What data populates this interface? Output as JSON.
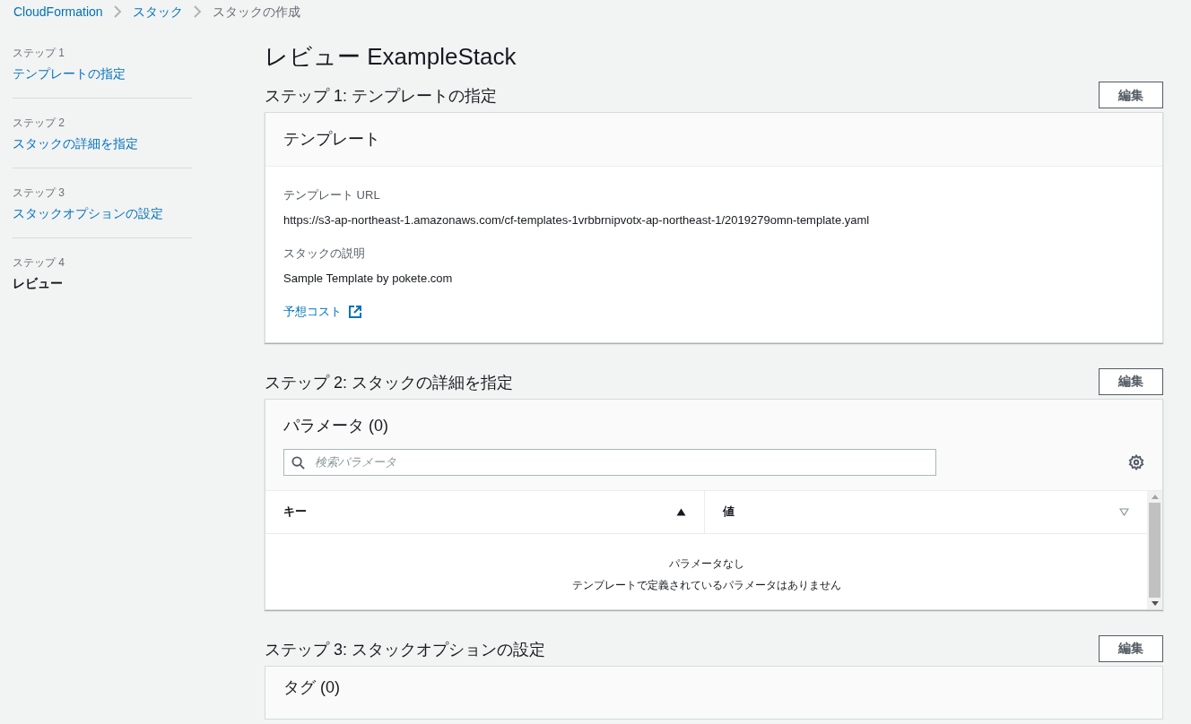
{
  "breadcrumb": [
    {
      "label": "CloudFormation",
      "link": true
    },
    {
      "label": "スタック",
      "link": true
    },
    {
      "label": "スタックの作成",
      "link": false
    }
  ],
  "steps": [
    {
      "label": "ステップ 1",
      "title": "テンプレートの指定",
      "selected": false
    },
    {
      "label": "ステップ 2",
      "title": "スタックの詳細を指定",
      "selected": false
    },
    {
      "label": "ステップ 3",
      "title": "スタックオプションの設定",
      "selected": false
    },
    {
      "label": "ステップ 4",
      "title": "レビュー",
      "selected": true
    }
  ],
  "page_title": "レビュー ExampleStack",
  "sections": [
    {
      "heading": "ステップ 1: テンプレートの指定",
      "edit_button": "編集",
      "card": {
        "kind": "details",
        "title": "テンプレート",
        "fields": [
          {
            "label": "テンプレート URL",
            "value": "https://s3-ap-northeast-1.amazonaws.com/cf-templates-1vrbbrnipvotx-ap-northeast-1/2019279omn-template.yaml"
          },
          {
            "label": "スタックの説明",
            "value": "Sample Template by pokete.com"
          }
        ],
        "link": "予想コスト"
      }
    },
    {
      "heading": "ステップ 2: スタックの詳細を指定",
      "edit_button": "編集",
      "card": {
        "kind": "table",
        "title": "パラメータ (0)",
        "search": {
          "placeholder": "検索パラメータ"
        },
        "columns": [
          {
            "label": "キー",
            "sorted": true
          },
          {
            "label": "値",
            "sorted": false
          }
        ],
        "empty_title": "パラメータなし",
        "empty_text": "テンプレートで定義されているパラメータはありません"
      }
    },
    {
      "heading": "ステップ 3: スタックオプションの設定",
      "edit_button": "編集",
      "card": {
        "kind": "header",
        "title": "タグ (0)"
      }
    }
  ]
}
